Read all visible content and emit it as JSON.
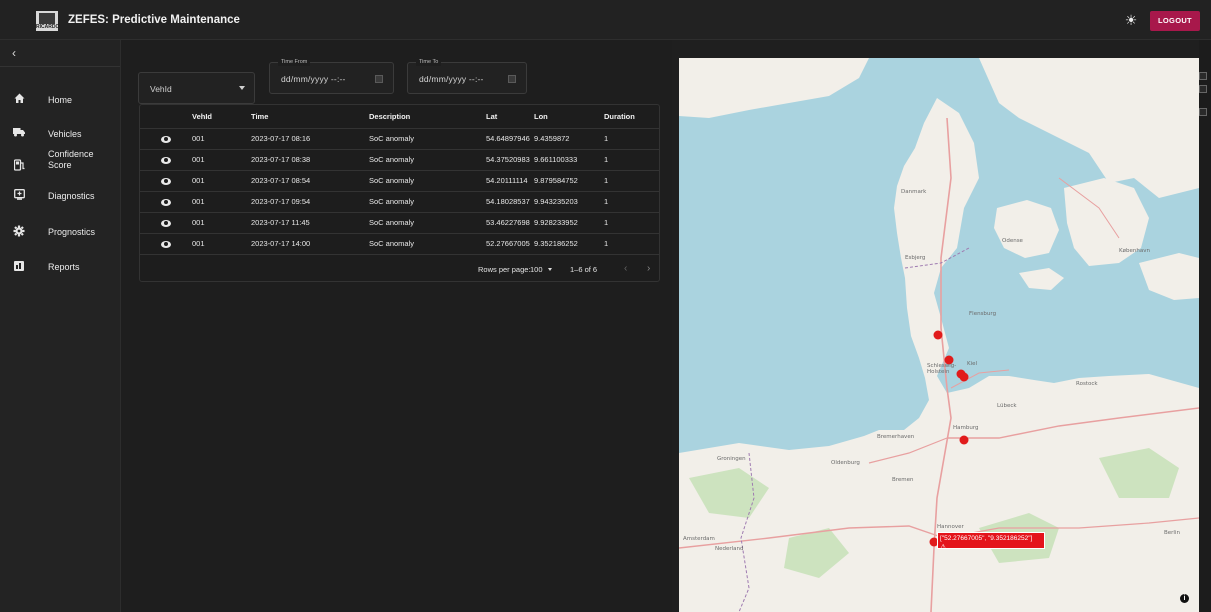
{
  "app": {
    "title": "ZEFES: Predictive Maintenance",
    "logo_text": "RICARDO",
    "logout_label": "LOGOUT"
  },
  "sidebar": {
    "items": [
      {
        "label": "Home",
        "icon": "home-icon"
      },
      {
        "label": "Vehicles",
        "icon": "truck-icon"
      },
      {
        "label": "Confidence Score",
        "icon": "gas-pump-icon"
      },
      {
        "label": "Diagnostics",
        "icon": "diagnostics-icon"
      },
      {
        "label": "Prognostics",
        "icon": "gear-icon"
      },
      {
        "label": "Reports",
        "icon": "bar-chart-icon"
      }
    ]
  },
  "filters": {
    "vehid_placeholder": "VehId",
    "time_from_label": "Time From",
    "time_from_value": "dd/mm/yyyy --:--",
    "time_to_label": "Time To",
    "time_to_value": "dd/mm/yyyy --:--"
  },
  "table": {
    "headers": [
      "",
      "VehId",
      "Time",
      "Description",
      "Lat",
      "Lon",
      "Duration"
    ],
    "rows": [
      {
        "vehid": "001",
        "time": "2023-07-17 08:16",
        "description": "SoC anomaly",
        "lat": "54.64897946",
        "lon": "9.4359872",
        "duration": "1"
      },
      {
        "vehid": "001",
        "time": "2023-07-17 08:38",
        "description": "SoC anomaly",
        "lat": "54.37520983",
        "lon": "9.661100333",
        "duration": "1"
      },
      {
        "vehid": "001",
        "time": "2023-07-17 08:54",
        "description": "SoC anomaly",
        "lat": "54.20111114",
        "lon": "9.879584752",
        "duration": "1"
      },
      {
        "vehid": "001",
        "time": "2023-07-17 09:54",
        "description": "SoC anomaly",
        "lat": "54.18028537",
        "lon": "9.943235203",
        "duration": "1"
      },
      {
        "vehid": "001",
        "time": "2023-07-17 11:45",
        "description": "SoC anomaly",
        "lat": "53.46227698",
        "lon": "9.928233952",
        "duration": "1"
      },
      {
        "vehid": "001",
        "time": "2023-07-17 14:00",
        "description": "SoC anomaly",
        "lat": "52.27667005",
        "lon": "9.352186252",
        "duration": "1"
      }
    ],
    "rows_per_page_label": "Rows per page:",
    "rows_per_page_value": "100",
    "range_label": "1–6 of 6"
  },
  "map": {
    "tooltip_text": "[\"52.27667005\", \"9.352186252\"]",
    "tooltip_icon": "⚠",
    "place_labels": [
      "Danmark",
      "Kiel",
      "Hamburg",
      "Bremen",
      "Hannover",
      "Nederland",
      "Berlin",
      "Lübeck",
      "Rostock",
      "København",
      "Odense",
      "Esbjerg",
      "Flensburg",
      "Amsterdam",
      "Groningen",
      "Bremerhaven",
      "Oldenburg",
      "Schleswig-Holstein"
    ],
    "marker_color": "#e11b1b",
    "water_color": "#aad3df",
    "land_color": "#f2efe9"
  },
  "theme": {
    "accent": "#a8184b",
    "bg": "#1f1f1f"
  }
}
